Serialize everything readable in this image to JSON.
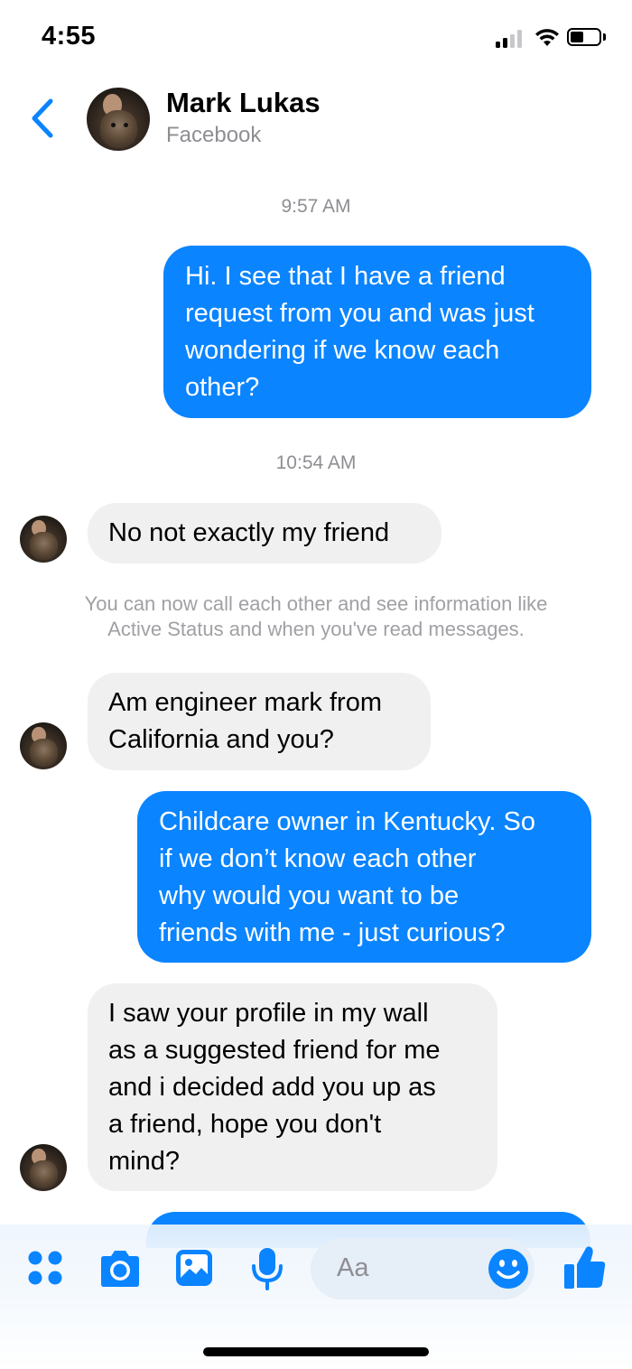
{
  "status_bar": {
    "time": "4:55"
  },
  "header": {
    "contact_name": "Mark Lukas",
    "source": "Facebook"
  },
  "conversation": {
    "timestamps": [
      "9:57 AM",
      "10:54 AM"
    ],
    "notice": [
      "You can now call each other and see information like",
      "Active Status and when you've read messages."
    ],
    "messages": [
      {
        "from": "me",
        "lines": [
          "Hi. I see that I have a friend",
          "request from you and was just",
          "wondering if we know each",
          "other?"
        ]
      },
      {
        "from": "them",
        "lines": [
          "No not exactly my friend"
        ]
      },
      {
        "from": "them",
        "lines": [
          "Am engineer mark from",
          "California and you?"
        ]
      },
      {
        "from": "me",
        "lines": [
          "Childcare owner in Kentucky. So",
          "if we don’t know each other",
          "why would you want to be",
          "friends with me - just curious?"
        ]
      },
      {
        "from": "them",
        "lines": [
          "I saw your profile in my wall",
          "as a suggested friend for me",
          "and i decided  add you up as",
          "a friend, hope you don't",
          "mind?"
        ]
      }
    ]
  },
  "composer": {
    "placeholder": "Aa"
  },
  "colors": {
    "accent": "#0a84ff",
    "incoming_bubble": "#f0f0f0"
  },
  "icons": [
    "back-icon",
    "apps-icon",
    "camera-icon",
    "photo-icon",
    "microphone-icon",
    "emoji-icon",
    "like-icon"
  ]
}
